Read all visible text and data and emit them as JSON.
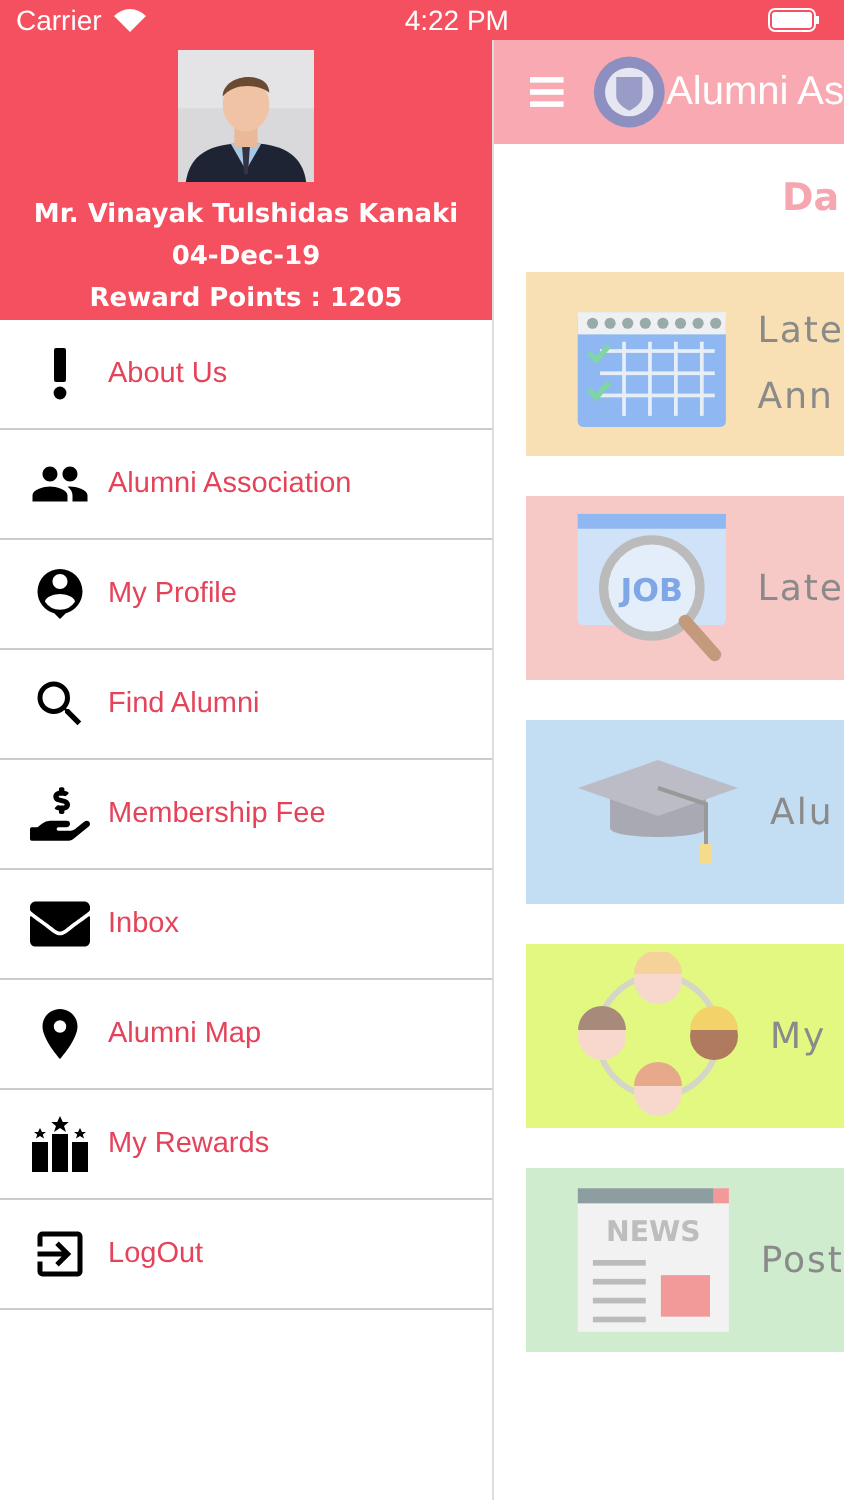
{
  "status_bar": {
    "carrier": "Carrier",
    "time": "4:22 PM"
  },
  "drawer": {
    "profile": {
      "name": "Mr. Vinayak Tulshidas Kanaki",
      "date": "04-Dec-19",
      "reward_points": "Reward Points : 1205"
    },
    "menu": [
      {
        "label": "About Us"
      },
      {
        "label": "Alumni Association"
      },
      {
        "label": "My Profile"
      },
      {
        "label": "Find Alumni"
      },
      {
        "label": "Membership Fee"
      },
      {
        "label": "Inbox"
      },
      {
        "label": "Alumni Map"
      },
      {
        "label": "My Rewards"
      },
      {
        "label": "LogOut"
      }
    ]
  },
  "main": {
    "nav_title": "Alumni As",
    "page_title": "Da",
    "cards": [
      {
        "lines": [
          "Late",
          "Ann"
        ],
        "color": "#f8dfb4"
      },
      {
        "lines": [
          "Late"
        ],
        "color": "#f6c8c6",
        "icon_text": "JOB"
      },
      {
        "lines": [
          "Alu"
        ],
        "color": "#c3def3"
      },
      {
        "lines": [
          "My"
        ],
        "color": "#e3f880"
      },
      {
        "lines": [
          "Post"
        ],
        "color": "#cfeccf",
        "icon_text": "NEWS"
      }
    ]
  }
}
